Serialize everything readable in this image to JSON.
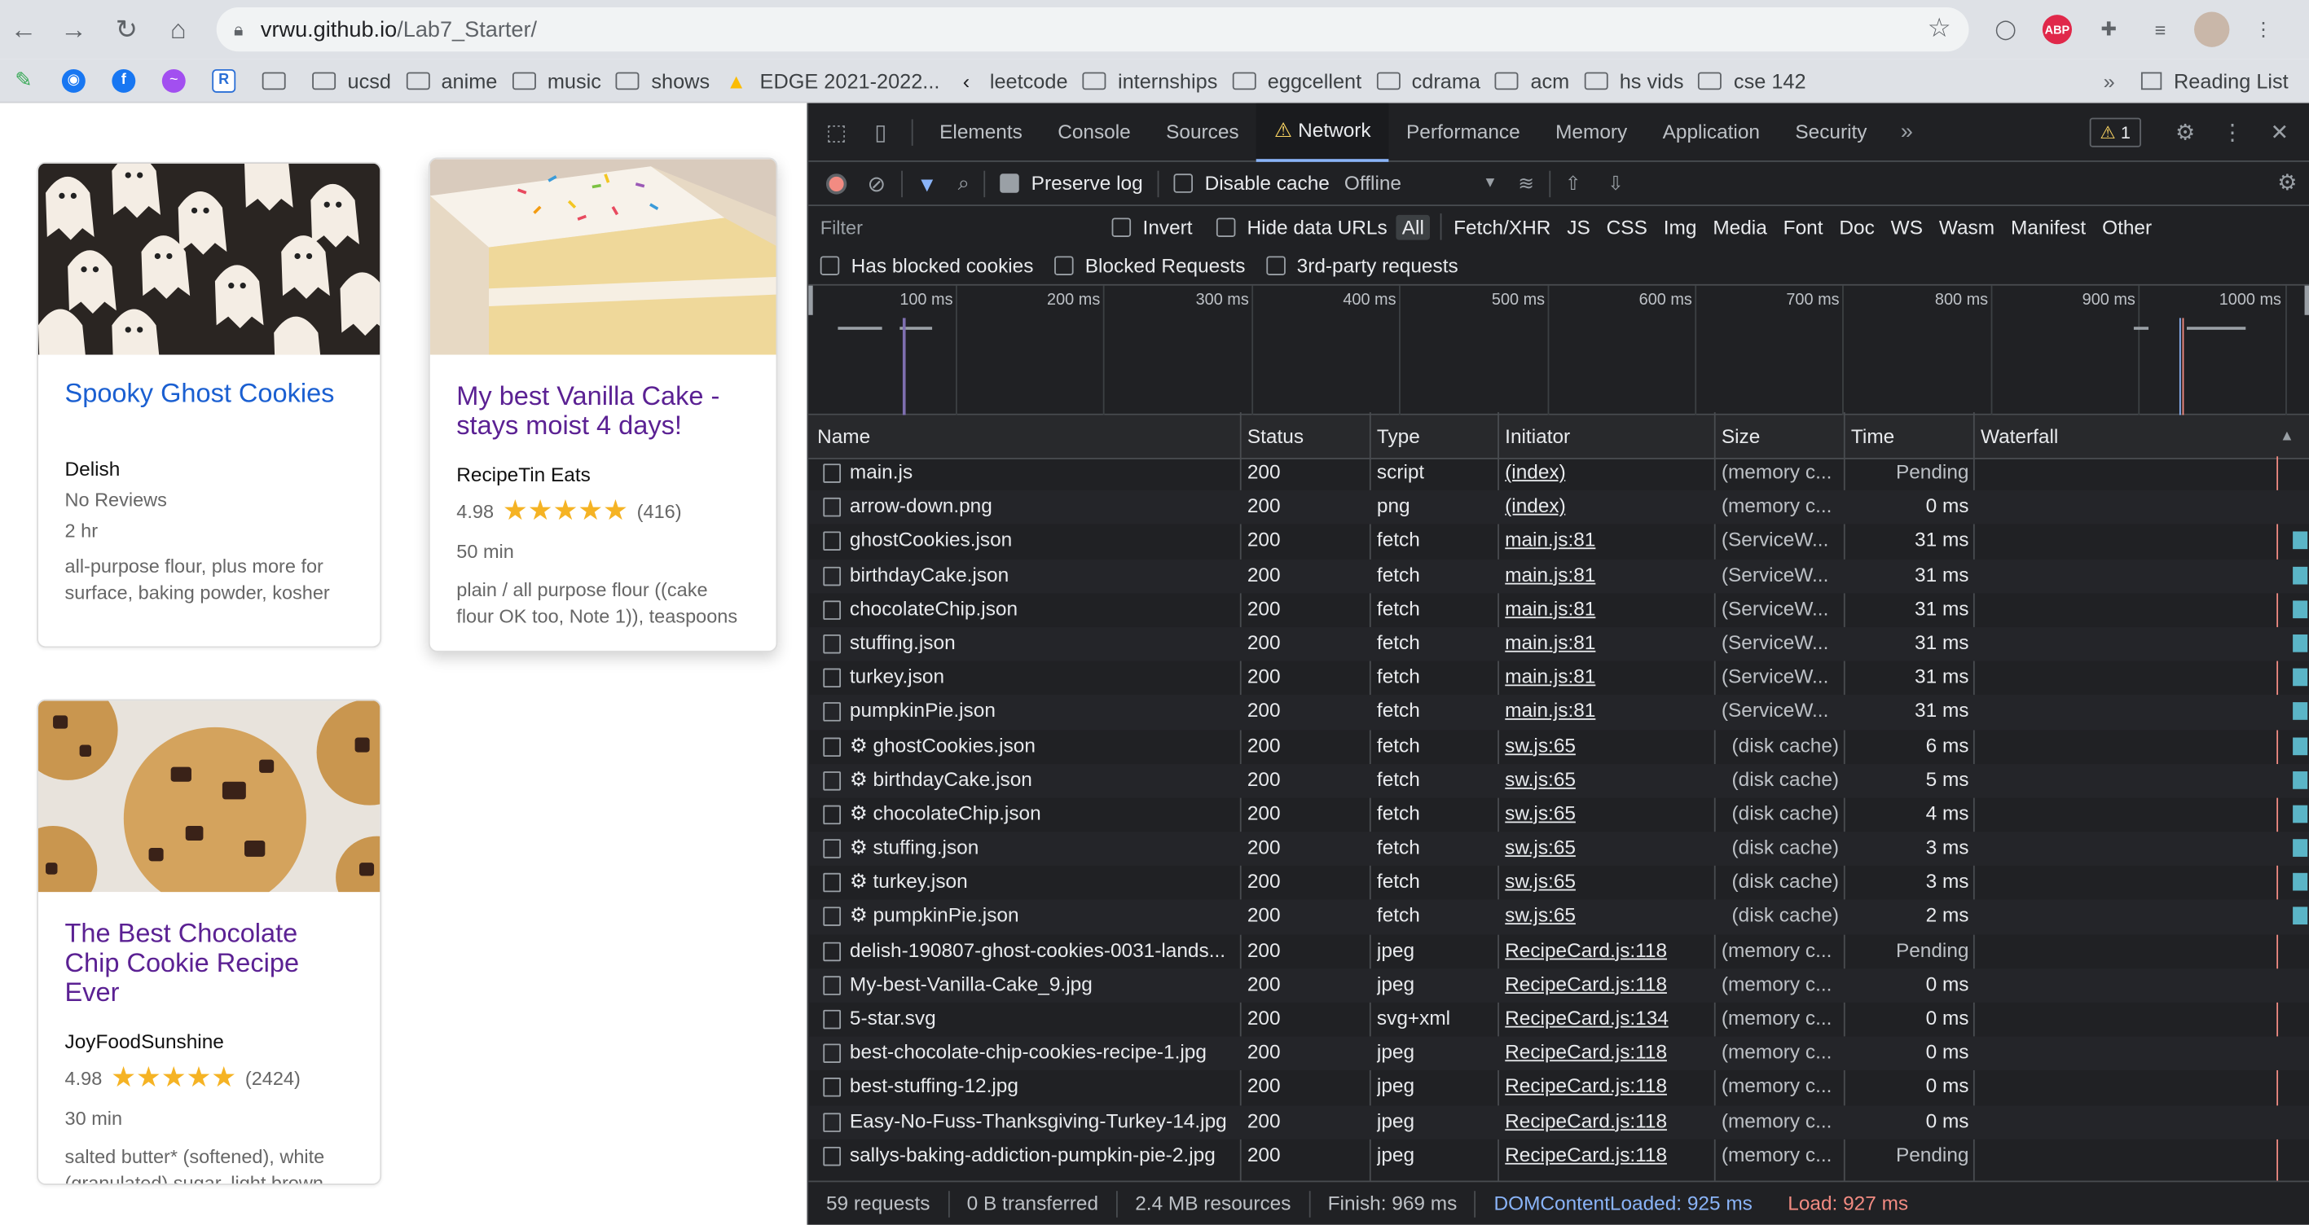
{
  "browser": {
    "url_host": "vrwu.github.io",
    "url_path": "/Lab7_Starter/",
    "ext_abp": "ABP",
    "bookmarks": [
      "ucsd",
      "anime",
      "music",
      "shows",
      "EDGE 2021-2022...",
      "leetcode",
      "internships",
      "eggcellent",
      "cdrama",
      "acm",
      "hs vids",
      "cse 142"
    ],
    "more": "»",
    "reading_list": "Reading List"
  },
  "cards": [
    {
      "title": "Spooky Ghost Cookies",
      "org": "Delish",
      "rating_text": "No Reviews",
      "time": "2 hr",
      "ingredients": "all-purpose flour, plus more for surface, baking powder, kosher"
    },
    {
      "title": "My best Vanilla Cake - stays moist 4 days!",
      "org": "RecipeTin Eats",
      "rating": "4.98",
      "reviews": "(416)",
      "time": "50 min",
      "ingredients": "plain / all purpose flour ((cake flour OK too, Note 1)), teaspoons"
    },
    {
      "title": "The Best Chocolate Chip Cookie Recipe Ever",
      "org": "JoyFoodSunshine",
      "rating": "4.98",
      "reviews": "(2424)",
      "time": "30 min",
      "ingredients": "salted butter* (softened), white (granulated) sugar, light brown"
    }
  ],
  "devtools": {
    "tabs": [
      "Elements",
      "Console",
      "Sources",
      "Network",
      "Performance",
      "Memory",
      "Application",
      "Security"
    ],
    "warn_count": "1",
    "preserve_log": "Preserve log",
    "disable_cache": "Disable cache",
    "throttle": "Offline",
    "filter_placeholder": "Filter",
    "invert": "Invert",
    "hide_data_urls": "Hide data URLs",
    "types": [
      "All",
      "Fetch/XHR",
      "JS",
      "CSS",
      "Img",
      "Media",
      "Font",
      "Doc",
      "WS",
      "Wasm",
      "Manifest",
      "Other"
    ],
    "has_blocked_cookies": "Has blocked cookies",
    "blocked_requests": "Blocked Requests",
    "third_party": "3rd-party requests",
    "ticks": [
      "100 ms",
      "200 ms",
      "300 ms",
      "400 ms",
      "500 ms",
      "600 ms",
      "700 ms",
      "800 ms",
      "900 ms",
      "1000 ms"
    ],
    "columns": [
      "Name",
      "Status",
      "Type",
      "Initiator",
      "Size",
      "Time",
      "Waterfall"
    ],
    "rows": [
      {
        "name": "main.js",
        "status": "200",
        "type": "script",
        "initiator": "(index)",
        "size": "(memory c...",
        "time": "Pending"
      },
      {
        "name": "arrow-down.png",
        "status": "200",
        "type": "png",
        "initiator": "(index)",
        "size": "(memory c...",
        "time": "0 ms"
      },
      {
        "name": "ghostCookies.json",
        "status": "200",
        "type": "fetch",
        "initiator": "main.js:81",
        "size": "(ServiceW...",
        "time": "31 ms"
      },
      {
        "name": "birthdayCake.json",
        "status": "200",
        "type": "fetch",
        "initiator": "main.js:81",
        "size": "(ServiceW...",
        "time": "31 ms"
      },
      {
        "name": "chocolateChip.json",
        "status": "200",
        "type": "fetch",
        "initiator": "main.js:81",
        "size": "(ServiceW...",
        "time": "31 ms"
      },
      {
        "name": "stuffing.json",
        "status": "200",
        "type": "fetch",
        "initiator": "main.js:81",
        "size": "(ServiceW...",
        "time": "31 ms"
      },
      {
        "name": "turkey.json",
        "status": "200",
        "type": "fetch",
        "initiator": "main.js:81",
        "size": "(ServiceW...",
        "time": "31 ms"
      },
      {
        "name": "pumpkinPie.json",
        "status": "200",
        "type": "fetch",
        "initiator": "main.js:81",
        "size": "(ServiceW...",
        "time": "31 ms"
      },
      {
        "name": "⚙ ghostCookies.json",
        "status": "200",
        "type": "fetch",
        "initiator": "sw.js:65",
        "size": "(disk cache)",
        "time": "6 ms"
      },
      {
        "name": "⚙ birthdayCake.json",
        "status": "200",
        "type": "fetch",
        "initiator": "sw.js:65",
        "size": "(disk cache)",
        "time": "5 ms"
      },
      {
        "name": "⚙ chocolateChip.json",
        "status": "200",
        "type": "fetch",
        "initiator": "sw.js:65",
        "size": "(disk cache)",
        "time": "4 ms"
      },
      {
        "name": "⚙ stuffing.json",
        "status": "200",
        "type": "fetch",
        "initiator": "sw.js:65",
        "size": "(disk cache)",
        "time": "3 ms"
      },
      {
        "name": "⚙ turkey.json",
        "status": "200",
        "type": "fetch",
        "initiator": "sw.js:65",
        "size": "(disk cache)",
        "time": "3 ms"
      },
      {
        "name": "⚙ pumpkinPie.json",
        "status": "200",
        "type": "fetch",
        "initiator": "sw.js:65",
        "size": "(disk cache)",
        "time": "2 ms"
      },
      {
        "name": "delish-190807-ghost-cookies-0031-lands...",
        "status": "200",
        "type": "jpeg",
        "initiator": "RecipeCard.js:118",
        "size": "(memory c...",
        "time": "Pending"
      },
      {
        "name": "My-best-Vanilla-Cake_9.jpg",
        "status": "200",
        "type": "jpeg",
        "initiator": "RecipeCard.js:118",
        "size": "(memory c...",
        "time": "0 ms"
      },
      {
        "name": "5-star.svg",
        "status": "200",
        "type": "svg+xml",
        "initiator": "RecipeCard.js:134",
        "size": "(memory c...",
        "time": "0 ms"
      },
      {
        "name": "best-chocolate-chip-cookies-recipe-1.jpg",
        "status": "200",
        "type": "jpeg",
        "initiator": "RecipeCard.js:118",
        "size": "(memory c...",
        "time": "0 ms"
      },
      {
        "name": "best-stuffing-12.jpg",
        "status": "200",
        "type": "jpeg",
        "initiator": "RecipeCard.js:118",
        "size": "(memory c...",
        "time": "0 ms"
      },
      {
        "name": "Easy-No-Fuss-Thanksgiving-Turkey-14.jpg",
        "status": "200",
        "type": "jpeg",
        "initiator": "RecipeCard.js:118",
        "size": "(memory c...",
        "time": "0 ms"
      },
      {
        "name": "sallys-baking-addiction-pumpkin-pie-2.jpg",
        "status": "200",
        "type": "jpeg",
        "initiator": "RecipeCard.js:118",
        "size": "(memory c...",
        "time": "Pending"
      }
    ],
    "status_bar": {
      "requests": "59 requests",
      "transferred": "0 B transferred",
      "resources": "2.4 MB resources",
      "finish": "Finish: 969 ms",
      "dcl": "DOMContentLoaded: 925 ms",
      "load": "Load: 927 ms"
    }
  }
}
